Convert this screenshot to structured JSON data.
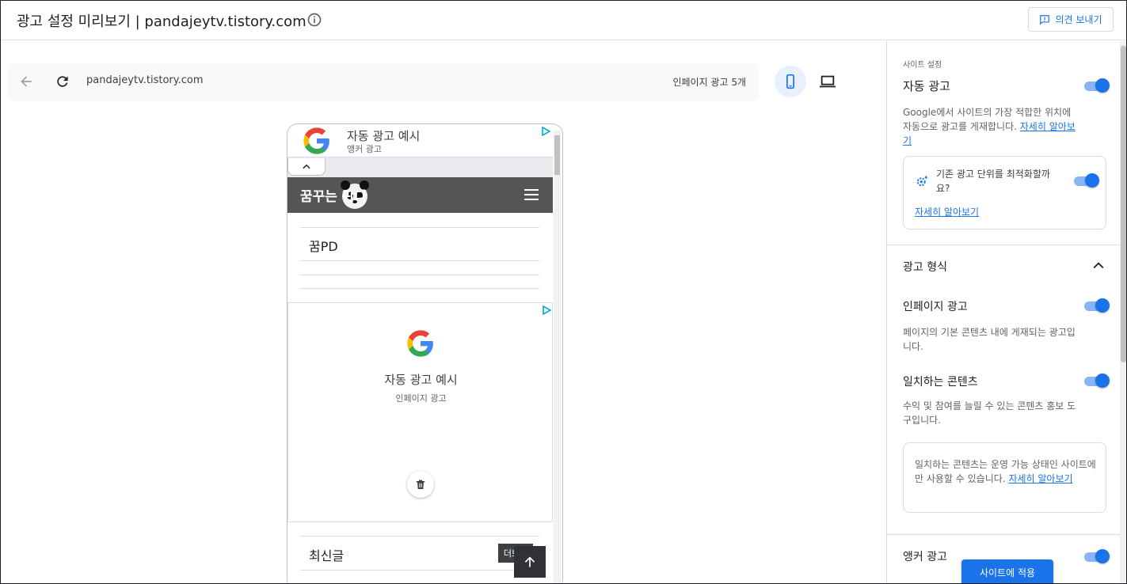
{
  "header": {
    "title": "광고 설정 미리보기 | pandajeytv.tistory.com",
    "feedback_label": "의견 보내기"
  },
  "urlbar": {
    "url": "pandajeytv.tistory.com",
    "ad_count": "인페이지 광고 5개"
  },
  "preview": {
    "anchor_ad": {
      "title": "자동 광고 예시",
      "subtitle": "앵커 광고"
    },
    "blog_title": "꿈꾸는 판다",
    "post_title": "꿈PD",
    "inpage_ad": {
      "title": "자동 광고 예시",
      "subtitle": "인페이지 광고"
    },
    "recent_label": "최신글",
    "more_label": "더보기"
  },
  "panel": {
    "section_label": "사이트 설정",
    "auto_ads": {
      "title": "자동 광고",
      "desc": "Google에서 사이트의 가장 적합한 위치에 자동으로 광고를 게재합니다.",
      "link": "자세히 알아보기",
      "enabled": true
    },
    "optimize_card": {
      "text": "기존 광고 단위를 최적화할까요?",
      "link": "자세히 알아보기",
      "enabled": true
    },
    "ad_formats": {
      "title": "광고 형식",
      "items": [
        {
          "title": "인페이지 광고",
          "desc": "페이지의 기본 콘텐츠 내에 게재되는 광고입니다.",
          "enabled": true
        },
        {
          "title": "일치하는 콘텐츠",
          "desc": "수익 및 참여를 늘릴 수 있는 콘텐츠 홍보 도구입니다.",
          "enabled": true
        }
      ],
      "note": "일치하는 콘텐츠는 운영 가능 상태인 사이트에만 사용할 수 있습니다.",
      "note_link": "자세히 알아보기",
      "partial_item": "앵커 광고"
    },
    "apply_label": "사이트에 적용"
  },
  "colors": {
    "accent": "#1a73e8",
    "toggle_track": "#8ab4f8",
    "blog_header": "#555555"
  }
}
